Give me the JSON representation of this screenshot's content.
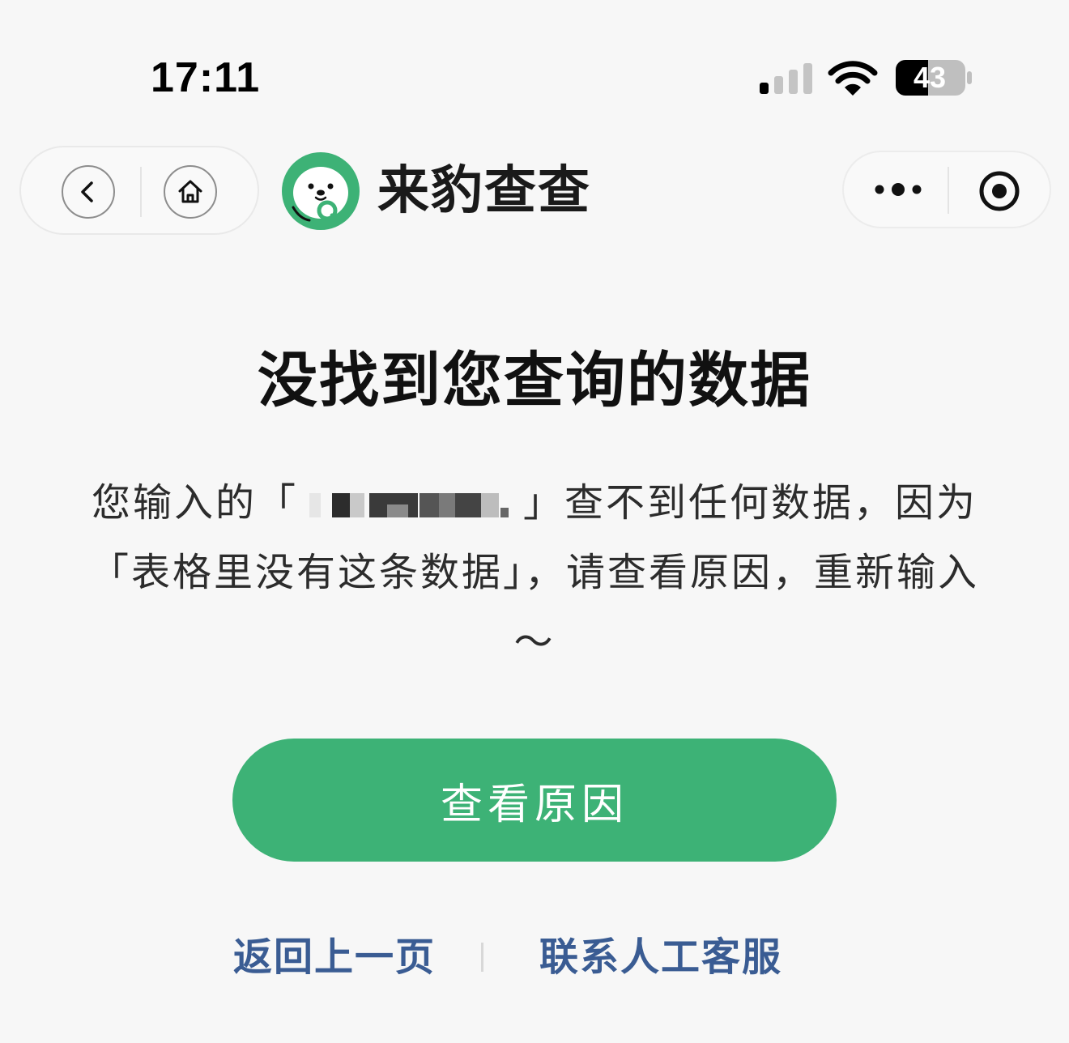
{
  "status_bar": {
    "time": "17:11",
    "battery_level": "43",
    "icons": [
      "cellular-signal-icon",
      "wifi-icon",
      "battery-icon"
    ]
  },
  "nav": {
    "back_icon": "chevron-left-icon",
    "home_icon": "home-icon",
    "brand_name": "来豹查查",
    "more_icon": "more-dots-icon",
    "close_icon": "target-icon"
  },
  "content": {
    "title": "没找到您查询的数据",
    "message_prefix": "您输入的「",
    "message_suffix": "」查不到任何数据，因为「表格里没有这条数据」，请查看原因，重新输入～",
    "primary_button": "查看原因",
    "link_back": "返回上一页",
    "link_service": "联系人工客服"
  },
  "colors": {
    "accent": "#3db276",
    "link": "#3a5c93",
    "background": "#f7f7f7"
  }
}
